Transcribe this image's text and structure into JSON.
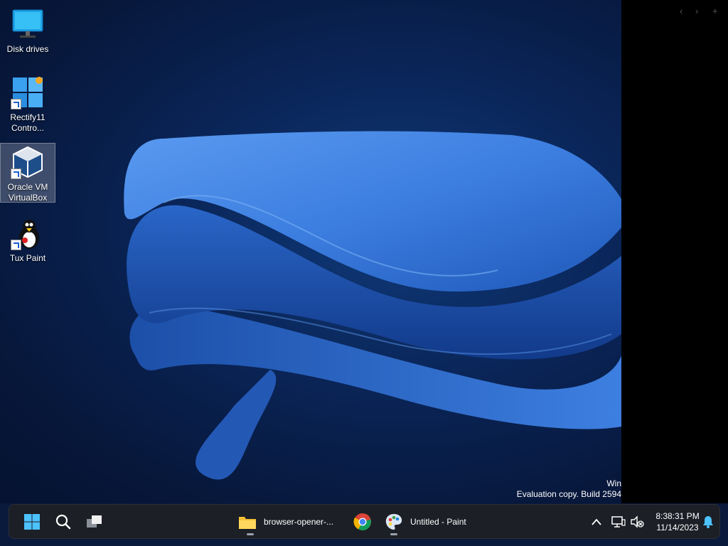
{
  "desktop": {
    "icons": [
      {
        "label_line1": "Disk drives",
        "label_line2": ""
      },
      {
        "label_line1": "Rectify11",
        "label_line2": "Contro..."
      },
      {
        "label_line1": "Oracle VM",
        "label_line2": "VirtualBox"
      },
      {
        "label_line1": "Tux Paint",
        "label_line2": ""
      }
    ],
    "watermark": {
      "line1": "Win",
      "line2": "Evaluation copy. Build 2594"
    }
  },
  "right_panel": {
    "nav_back": "‹",
    "nav_forward": "›",
    "nav_add": "+"
  },
  "taskbar": {
    "apps": [
      {
        "label": "browser-opener-..."
      },
      {
        "label": ""
      },
      {
        "label": "Untitled - Paint"
      }
    ],
    "tray": {
      "overflow_glyph": "^",
      "time": "8:38:31 PM",
      "date": "11/14/2023"
    }
  },
  "colors": {
    "wallpaper_blue": "#3a7bd5",
    "taskbar_bg": "#1c1f26",
    "start_blue": "#4cc2ff"
  }
}
